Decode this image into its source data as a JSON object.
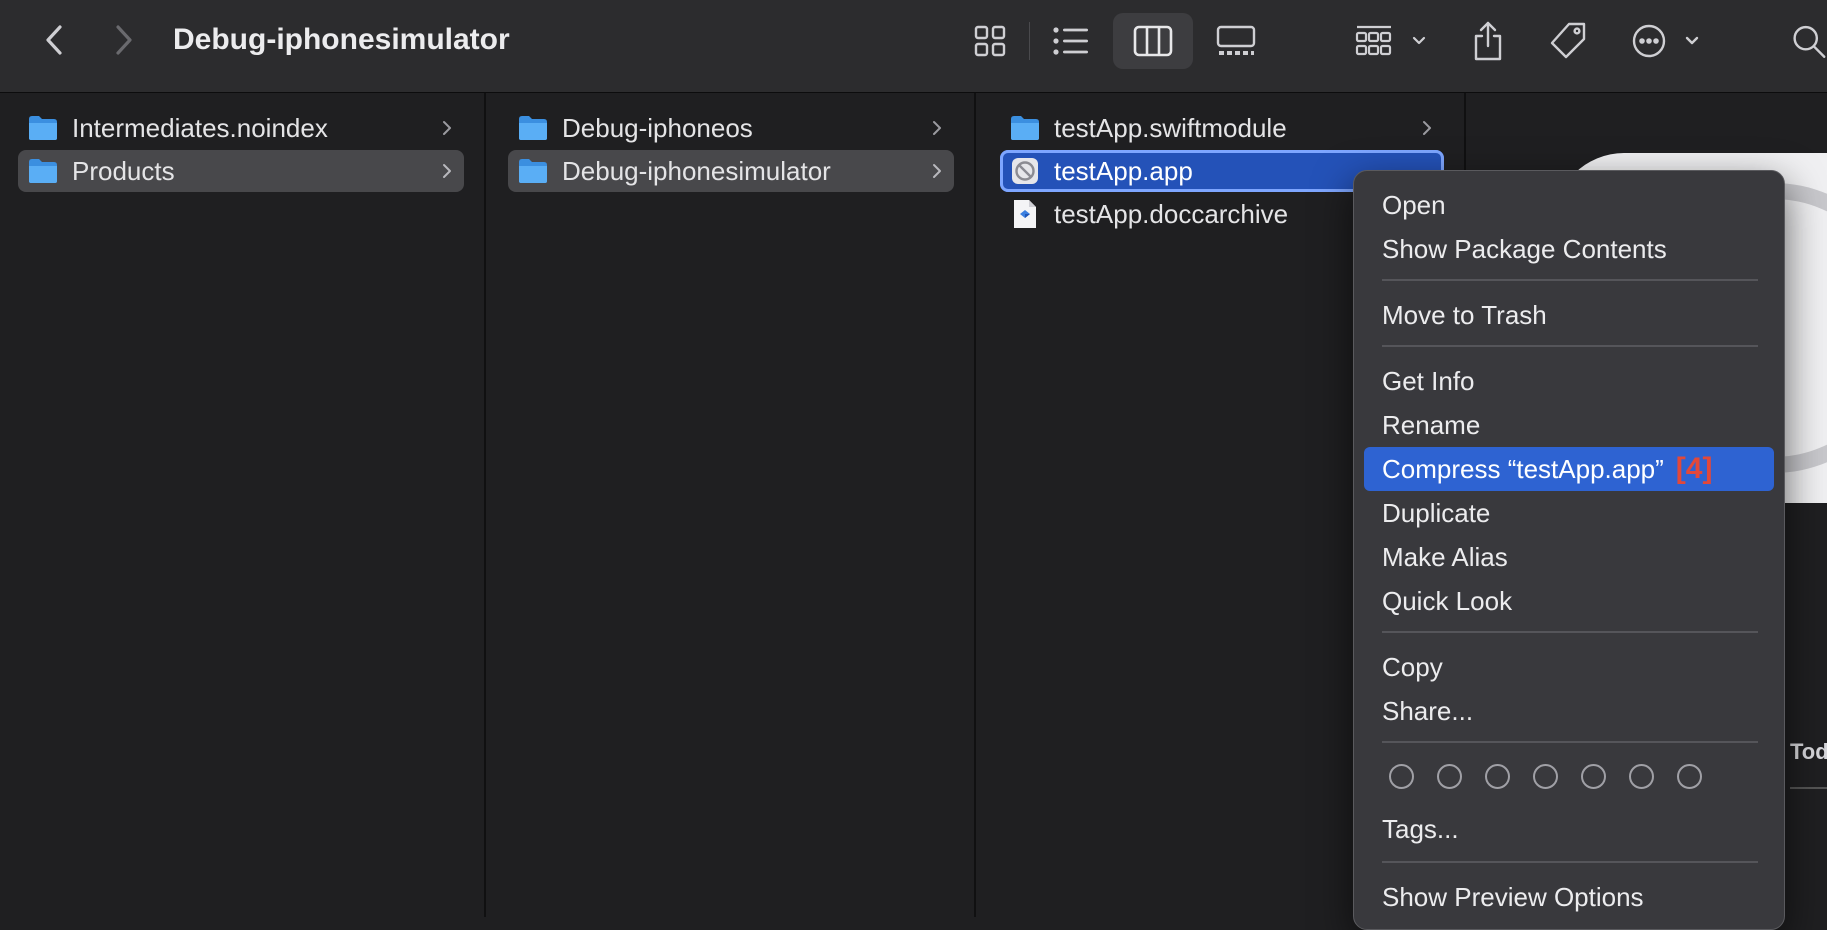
{
  "toolbar": {
    "title": "Debug-iphonesimulator",
    "icons": [
      "back-chevron-icon",
      "forward-chevron-icon",
      "icon-view-icon",
      "list-view-icon",
      "column-view-icon",
      "gallery-view-icon",
      "group-icon",
      "share-icon",
      "tag-icon",
      "more-actions-icon",
      "search-icon"
    ]
  },
  "columns": [
    {
      "items": [
        {
          "label": "Intermediates.noindex",
          "type": "folder"
        },
        {
          "label": "Products",
          "type": "folder",
          "selected": true
        }
      ]
    },
    {
      "items": [
        {
          "label": "Debug-iphoneos",
          "type": "folder"
        },
        {
          "label": "Debug-iphonesimulator",
          "type": "folder",
          "selected": true
        }
      ]
    },
    {
      "items": [
        {
          "label": "testApp.swiftmodule",
          "type": "folder"
        },
        {
          "label": "testApp.app",
          "type": "app",
          "selected": true
        },
        {
          "label": "testApp.doccarchive",
          "type": "document"
        }
      ]
    }
  ],
  "context_menu": {
    "items": [
      {
        "label": "Open"
      },
      {
        "label": "Show Package Contents"
      },
      {
        "label": "Move to Trash"
      },
      {
        "label": "Get Info"
      },
      {
        "label": "Rename"
      },
      {
        "label": "Compress “testApp.app”",
        "highlighted": true,
        "badge": "[4]"
      },
      {
        "label": "Duplicate"
      },
      {
        "label": "Make Alias"
      },
      {
        "label": "Quick Look"
      },
      {
        "label": "Copy"
      },
      {
        "label": "Share..."
      },
      {
        "label": "Tags..."
      },
      {
        "label": "Show Preview Options"
      }
    ],
    "tag_colors": [
      "none",
      "none",
      "none",
      "none",
      "none",
      "none",
      "none"
    ]
  },
  "preview": {
    "date_fragment": "Tod"
  },
  "colors": {
    "accent": "#2e63d2",
    "selection_blue": "#2452b8",
    "badge": "#e2483a",
    "folder": "#4aa3f2"
  }
}
